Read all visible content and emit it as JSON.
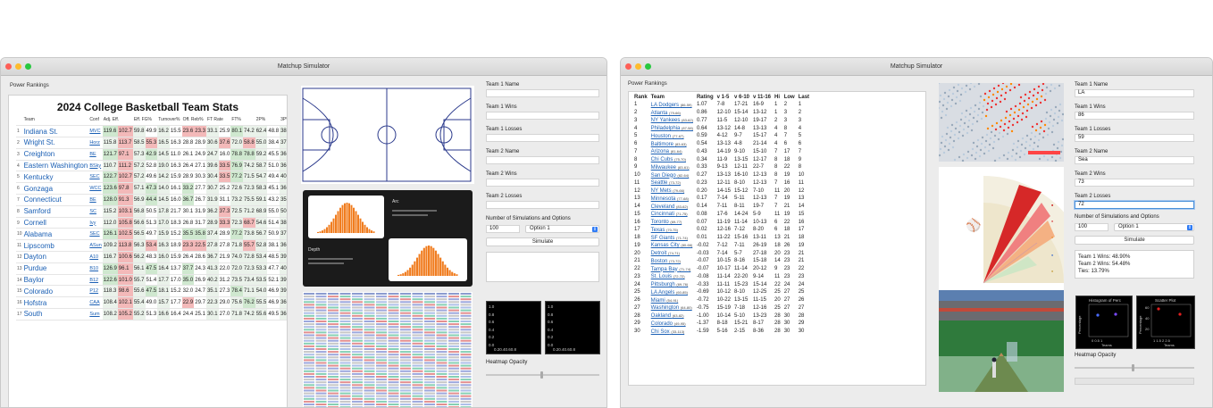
{
  "left": {
    "title": "Matchup Simulator",
    "power_rankings": "Power Rankings",
    "stats": {
      "title": "2024 College Basketball Team Stats",
      "headers": [
        "Team",
        "Conf",
        "Adj. Eff.",
        "Eff. FG%",
        "Turnover%",
        "Off. Reb%",
        "FT Rate",
        "FT%",
        "2P%",
        "3P%"
      ],
      "rows": [
        {
          "rank": "1",
          "team": "Indiana St.",
          "conf": "MVC",
          "v": [
            "119.6",
            "102.7",
            "59.8",
            "49.9",
            "16.2",
            "15.5",
            "23.6",
            "23.3",
            "33.1",
            "25.9",
            "80.1",
            "74.2",
            "62.4",
            "48.8",
            "38.1",
            "34.7"
          ]
        },
        {
          "rank": "2",
          "team": "Wright St.",
          "conf": "Horz",
          "v": [
            "115.8",
            "113.7",
            "58.5",
            "55.3",
            "16.5",
            "16.3",
            "28.8",
            "28.9",
            "30.6",
            "37.6",
            "72.0",
            "58.8",
            "55.0",
            "38.4",
            "37.1",
            ""
          ]
        },
        {
          "rank": "3",
          "team": "Creighton",
          "conf": "BE",
          "v": [
            "121.7",
            "97.1",
            "57.3",
            "42.9",
            "14.5",
            "11.0",
            "26.1",
            "24.9",
            "24.7",
            "16.0",
            "78.8",
            "78.8",
            "59.2",
            "45.5",
            "36.8",
            "32.3"
          ]
        },
        {
          "rank": "4",
          "team": "Eastern Washington",
          "conf": "BSky",
          "v": [
            "110.7",
            "111.2",
            "57.2",
            "52.8",
            "19.0",
            "16.3",
            "26.4",
            "27.1",
            "39.6",
            "33.5",
            "76.9",
            "74.2",
            "58.7",
            "51.0",
            "36.8",
            "36.9"
          ]
        },
        {
          "rank": "5",
          "team": "Kentucky",
          "conf": "SEC",
          "v": [
            "122.7",
            "102.7",
            "57.2",
            "49.6",
            "14.2",
            "15.9",
            "28.9",
            "30.3",
            "30.4",
            "33.5",
            "77.2",
            "71.5",
            "54.7",
            "49.4",
            "40.9",
            "33.2"
          ]
        },
        {
          "rank": "6",
          "team": "Gonzaga",
          "conf": "WCC",
          "v": [
            "123.6",
            "97.8",
            "57.1",
            "47.3",
            "14.0",
            "16.1",
            "33.2",
            "27.7",
            "30.7",
            "25.2",
            "72.6",
            "72.3",
            "58.3",
            "45.1",
            "36.2",
            "34.1"
          ]
        },
        {
          "rank": "7",
          "team": "Connecticut",
          "conf": "BE",
          "v": [
            "128.0",
            "91.3",
            "56.9",
            "44.4",
            "14.5",
            "16.0",
            "36.7",
            "26.7",
            "31.9",
            "31.1",
            "73.2",
            "75.5",
            "59.1",
            "43.2",
            "35.8",
            "31.2"
          ]
        },
        {
          "rank": "8",
          "team": "Samford",
          "conf": "SC",
          "v": [
            "115.2",
            "103.1",
            "56.8",
            "50.5",
            "17.8",
            "21.7",
            "30.1",
            "31.9",
            "36.2",
            "37.3",
            "72.5",
            "71.2",
            "68.9",
            "55.0",
            "50.3",
            "39.5"
          ]
        },
        {
          "rank": "9",
          "team": "Cornell",
          "conf": "Ivy",
          "v": [
            "112.0",
            "105.8",
            "56.6",
            "51.3",
            "17.0",
            "18.3",
            "26.8",
            "31.7",
            "28.9",
            "33.3",
            "72.3",
            "68.7",
            "54.6",
            "51.4",
            "38.3",
            "33.8"
          ]
        },
        {
          "rank": "10",
          "team": "Alabama",
          "conf": "SEC",
          "v": [
            "126.1",
            "102.5",
            "56.5",
            "49.7",
            "15.9",
            "15.2",
            "35.5",
            "35.8",
            "37.4",
            "28.9",
            "77.2",
            "73.8",
            "56.7",
            "50.9",
            "37.3",
            "31.7"
          ]
        },
        {
          "rank": "11",
          "team": "Lipscomb",
          "conf": "ASun",
          "v": [
            "109.2",
            "113.8",
            "56.3",
            "53.4",
            "16.3",
            "18.9",
            "23.3",
            "22.5",
            "27.8",
            "27.8",
            "71.8",
            "55.7",
            "52.8",
            "38.1",
            "36.5",
            ""
          ]
        },
        {
          "rank": "12",
          "team": "Dayton",
          "conf": "A10",
          "v": [
            "116.7",
            "100.6",
            "56.2",
            "48.3",
            "16.0",
            "15.9",
            "26.4",
            "28.6",
            "36.7",
            "21.9",
            "74.0",
            "72.8",
            "53.4",
            "48.5",
            "39.9",
            "32.0"
          ]
        },
        {
          "rank": "13",
          "team": "Purdue",
          "conf": "B10",
          "v": [
            "126.9",
            "96.1",
            "56.1",
            "47.5",
            "16.4",
            "13.7",
            "37.7",
            "24.3",
            "41.3",
            "22.0",
            "72.0",
            "72.3",
            "53.3",
            "47.7",
            "40.4",
            "31.5"
          ]
        },
        {
          "rank": "14",
          "team": "Baylor",
          "conf": "B12",
          "v": [
            "122.6",
            "101.0",
            "55.7",
            "51.4",
            "17.7",
            "17.0",
            "35.0",
            "26.9",
            "40.2",
            "31.2",
            "73.5",
            "73.4",
            "53.5",
            "52.1",
            "39.5",
            "33.4"
          ]
        },
        {
          "rank": "15",
          "team": "Colorado",
          "conf": "P12",
          "v": [
            "118.3",
            "98.6",
            "55.6",
            "47.5",
            "18.1",
            "15.2",
            "32.0",
            "24.7",
            "35.1",
            "27.3",
            "78.4",
            "71.1",
            "54.0",
            "46.9",
            "39.8",
            "32.6"
          ]
        },
        {
          "rank": "16",
          "team": "Hofstra",
          "conf": "CAA",
          "v": [
            "108.4",
            "102.1",
            "55.4",
            "49.0",
            "15.7",
            "17.7",
            "22.9",
            "29.7",
            "22.3",
            "29.0",
            "75.6",
            "76.2",
            "55.5",
            "46.9",
            "36.8",
            "34.6"
          ]
        },
        {
          "rank": "17",
          "team": "South",
          "conf": "Sum",
          "v": [
            "108.2",
            "105.2",
            "55.2",
            "51.3",
            "16.6",
            "16.4",
            "24.4",
            "25.1",
            "30.1",
            "27.0",
            "71.8",
            "74.2",
            "55.6",
            "49.5",
            "36.4",
            "35.5"
          ]
        }
      ]
    },
    "form": {
      "team1_name": "Team 1 Name",
      "team1_name_value": "",
      "team1_wins": "Team 1 Wins",
      "team1_wins_value": "",
      "team1_losses": "Team 1 Losses",
      "team1_losses_value": "",
      "team2_name": "Team 2 Name",
      "team2_name_value": "",
      "team2_wins": "Team 2 Wins",
      "team2_wins_value": "",
      "team2_losses": "Team 2 Losses",
      "team2_losses_value": "",
      "sims_label": "Number of Simulations and Options",
      "sims_value": "100",
      "option": "Option 1",
      "simulate": "Simulate",
      "heatmap": "Heatmap Opacity",
      "plot_ticks_y": [
        "1.0",
        "0.8",
        "0.6",
        "0.4",
        "0.2",
        "0.0"
      ],
      "plot_ticks_x": "0.20.40.60.8"
    },
    "thumb": {
      "arc": "Arc",
      "depth": "Depth"
    }
  },
  "right": {
    "title": "Matchup Simulator",
    "power_rankings": "Power Rankings",
    "headers": [
      "Rank",
      "Team",
      "Rating",
      "v 1-5",
      "v 6-10",
      "v 11-16",
      "Hi",
      "Low",
      "Last"
    ],
    "rows": [
      [
        "1",
        "LA Dodgers",
        "(86-59)",
        "1.07",
        "7-8",
        "17-21",
        "16-9",
        "1",
        "2",
        "1"
      ],
      [
        "2",
        "Atlanta",
        "(79-66)",
        "0.86",
        "12-10",
        "15-14",
        "13-12",
        "1",
        "3",
        "2"
      ],
      [
        "3",
        "NY Yankees",
        "(83-62)",
        "0.77",
        "11-5",
        "12-10",
        "19-17",
        "2",
        "3",
        "3"
      ],
      [
        "4",
        "Philadelphia",
        "(87-58)",
        "0.64",
        "13-12",
        "14-8",
        "13-13",
        "4",
        "8",
        "4"
      ],
      [
        "5",
        "Houston",
        "(77-67)",
        "0.59",
        "4-12",
        "9-7",
        "15-17",
        "4",
        "7",
        "5"
      ],
      [
        "6",
        "Baltimore",
        "(83-63)",
        "0.54",
        "13-13",
        "4-8",
        "21-14",
        "4",
        "6",
        "6"
      ],
      [
        "7",
        "Arizona",
        "(81-64)",
        "0.43",
        "14-19",
        "9-10",
        "15-10",
        "7",
        "17",
        "7"
      ],
      [
        "8",
        "Chi Cubs",
        "(75-70)",
        "0.34",
        "11-9",
        "13-15",
        "12-17",
        "8",
        "18",
        "9"
      ],
      [
        "9",
        "Milwaukee",
        "(83-61)",
        "0.33",
        "9-13",
        "12-11",
        "22-7",
        "8",
        "22",
        "8"
      ],
      [
        "10",
        "San Diego",
        "(82-64)",
        "0.27",
        "13-13",
        "16-10",
        "12-13",
        "8",
        "19",
        "10"
      ],
      [
        "11",
        "Seattle",
        "(73-72)",
        "0.23",
        "12-11",
        "8-10",
        "12-13",
        "7",
        "16",
        "11"
      ],
      [
        "12",
        "NY Mets",
        "(79-66)",
        "0.20",
        "14-15",
        "15-12",
        "7-10",
        "11",
        "20",
        "12"
      ],
      [
        "13",
        "Minnesota",
        "(77-68)",
        "0.17",
        "7-14",
        "5-11",
        "12-13",
        "7",
        "19",
        "13"
      ],
      [
        "14",
        "Cleveland",
        "(83-62)",
        "0.14",
        "7-11",
        "8-11",
        "19-7",
        "7",
        "21",
        "14"
      ],
      [
        "15",
        "Cincinnati",
        "(71-75)",
        "0.08",
        "17-6",
        "14-24",
        "5-9",
        "11",
        "19",
        "15"
      ],
      [
        "16",
        "Toronto",
        "(69-77)",
        "0.07",
        "11-19",
        "11-14",
        "10-13",
        "6",
        "22",
        "16"
      ],
      [
        "17",
        "Texas",
        "(70-75)",
        "0.02",
        "12-16",
        "7-12",
        "8-20",
        "6",
        "18",
        "17"
      ],
      [
        "18",
        "SF Giants",
        "(71-74)",
        "0.01",
        "11-22",
        "15-16",
        "13-11",
        "13",
        "21",
        "18"
      ],
      [
        "19",
        "Kansas City",
        "(80-66)",
        "-0.02",
        "7-12",
        "7-11",
        "26-19",
        "18",
        "26",
        "19"
      ],
      [
        "20",
        "Detroit",
        "(74-71)",
        "-0.03",
        "7-14",
        "5-7",
        "27-18",
        "20",
        "23",
        "21"
      ],
      [
        "21",
        "Boston",
        "(73-72)",
        "-0.07",
        "10-15",
        "8-16",
        "15-18",
        "14",
        "23",
        "21"
      ],
      [
        "22",
        "Tampa Bay",
        "(71-74)",
        "-0.07",
        "10-17",
        "11-14",
        "20-12",
        "9",
        "23",
        "22"
      ],
      [
        "23",
        "St. Louis",
        "(72-72)",
        "-0.08",
        "11-14",
        "22-20",
        "9-14",
        "11",
        "23",
        "23"
      ],
      [
        "24",
        "Pittsburgh",
        "(69-76)",
        "-0.33",
        "11-11",
        "15-23",
        "15-14",
        "22",
        "24",
        "24"
      ],
      [
        "25",
        "LA Angels",
        "(60-85)",
        "-0.69",
        "10-12",
        "8-10",
        "12-25",
        "25",
        "27",
        "25"
      ],
      [
        "26",
        "Miami",
        "(54-91)",
        "-0.72",
        "10-22",
        "13-15",
        "11-15",
        "20",
        "27",
        "26"
      ],
      [
        "27",
        "Washington",
        "(64-80)",
        "-0.75",
        "15-19",
        "7-18",
        "12-16",
        "25",
        "27",
        "27"
      ],
      [
        "28",
        "Oakland",
        "(63-82)",
        "-1.00",
        "10-14",
        "5-10",
        "13-23",
        "28",
        "30",
        "28"
      ],
      [
        "29",
        "Colorado",
        "(49-95)",
        "-1.37",
        "8-18",
        "15-21",
        "8-17",
        "28",
        "30",
        "29"
      ],
      [
        "30",
        "Chi Sox",
        "(33-113)",
        "-1.59",
        "5-16",
        "2-15",
        "8-36",
        "28",
        "30",
        "30"
      ]
    ],
    "form": {
      "team1_name": "Team 1 Name",
      "team1_name_value": "LA",
      "team1_wins": "Team 1 Wins",
      "team1_wins_value": "86",
      "team1_losses": "Team 1 Losses",
      "team1_losses_value": "59",
      "team2_name": "Team 2 Name",
      "team2_name_value": "Sea",
      "team2_wins": "Team 2 Wins",
      "team2_wins_value": "73",
      "team2_losses": "Team 2 Losses",
      "team2_losses_value": "72",
      "sims_label": "Number of Simulations and Options",
      "sims_value": "100",
      "option": "Option 1",
      "simulate": "Simulate",
      "result1": "Team 1 Wins: 48.90%",
      "result2": "Team 2 Wins: 54.48%",
      "result3": "Ties: 13.79%",
      "heatmap": "Heatmap Opacity",
      "hist_title": "Histogram of Perc",
      "scatter_title": "Scatter Plot",
      "ylabel": "Percentage",
      "xlabel": "Teams",
      "hist_x": "0  0.5  1",
      "scatter_x": "1  1.5  2  2.5",
      "y_ticks": [
        "60",
        "40",
        "20"
      ]
    }
  }
}
